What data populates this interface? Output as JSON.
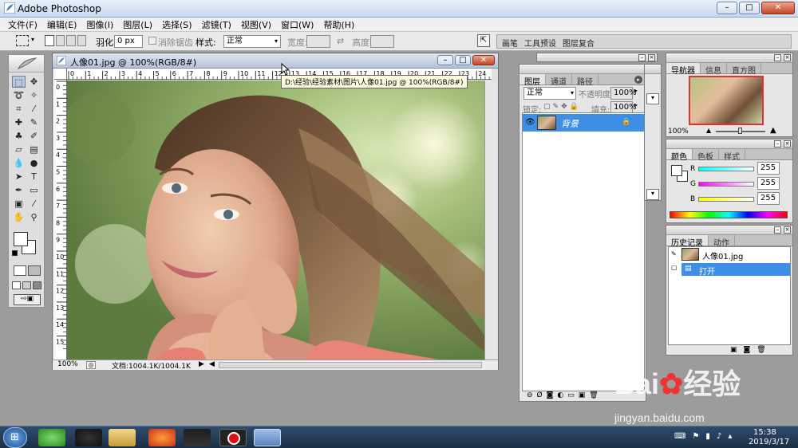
{
  "app": {
    "title": "Adobe Photoshop"
  },
  "menu": [
    "文件(F)",
    "编辑(E)",
    "图像(I)",
    "图层(L)",
    "选择(S)",
    "滤镜(T)",
    "视图(V)",
    "窗口(W)",
    "帮助(H)"
  ],
  "options": {
    "feather_label": "羽化:",
    "feather_value": "0 px",
    "antialias_label": "消除锯齿",
    "style_label": "样式:",
    "style_value": "正常",
    "width_label": "宽度:",
    "height_label": "高度:"
  },
  "palette_well": {
    "tabs": [
      "画笔",
      "工具预设",
      "图层复合"
    ]
  },
  "document": {
    "title": "人像01.jpg @ 100%(RGB/8#)",
    "tooltip": "D:\\经验\\经验素材\\图片\\人像01.jpg @ 100%(RGB/8#)",
    "zoom": "100%",
    "doc_size": "文档:1004.1K/1004.1K",
    "ruler_h": [
      "0",
      "1",
      "2",
      "3",
      "4",
      "5",
      "6",
      "7",
      "8",
      "9",
      "10",
      "11",
      "12",
      "13",
      "14",
      "15",
      "16",
      "17",
      "18",
      "19",
      "20",
      "21",
      "22",
      "23",
      "24"
    ],
    "ruler_v": [
      "0",
      "1",
      "2",
      "3",
      "4",
      "5",
      "6",
      "7",
      "8",
      "9",
      "10",
      "11",
      "12",
      "13",
      "14",
      "15"
    ]
  },
  "layers": {
    "tabs": [
      "图层",
      "通道",
      "路径"
    ],
    "blend_mode": "正常",
    "opacity_label": "不透明度:",
    "opacity": "100%",
    "lock_label": "锁定:",
    "fill_label": "填充:",
    "fill": "100%",
    "layer_name": "背景"
  },
  "navigator": {
    "tabs": [
      "导航器",
      "信息",
      "直方图"
    ],
    "zoom": "100%"
  },
  "color": {
    "tabs": [
      "颜色",
      "色板",
      "样式"
    ],
    "channels": [
      {
        "label": "R",
        "value": "255"
      },
      {
        "label": "G",
        "value": "255"
      },
      {
        "label": "B",
        "value": "255"
      }
    ]
  },
  "history": {
    "tabs": [
      "历史记录",
      "动作"
    ],
    "snapshot": "人像01.jpg",
    "step": "打开"
  },
  "clock": {
    "time": "15:38",
    "date": "2019/3/17"
  },
  "watermark": {
    "brand_1": "Bai",
    "brand_2": "经验",
    "url": "jingyan.baidu.com"
  },
  "colors": {
    "selected_layer": "#3f8ee6",
    "history_selected": "#3f8ee6",
    "taskbar": "#1b2f46"
  }
}
